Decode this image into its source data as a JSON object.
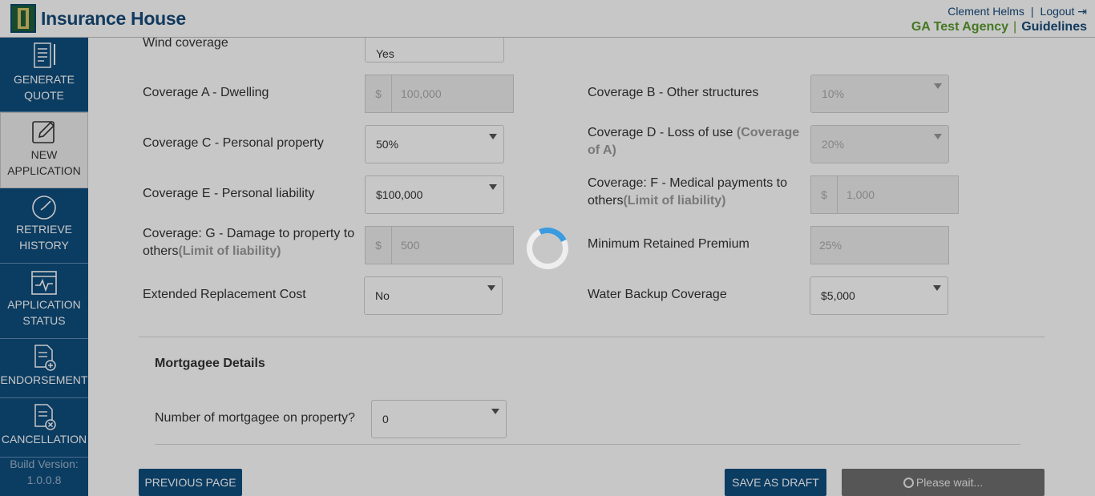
{
  "header": {
    "brand": "Insurance House",
    "user_name": "Clement Helms",
    "separator": "|",
    "logout": "Logout",
    "logout_icon": "⇥",
    "agency": "GA Test Agency",
    "guidelines": "Guidelines"
  },
  "sidebar": {
    "items": [
      {
        "label": "GENERATE QUOTE",
        "icon": "document-list-icon"
      },
      {
        "label": "NEW APPLICATION",
        "icon": "edit-document-icon"
      },
      {
        "label": "RETRIEVE HISTORY",
        "icon": "history-icon"
      },
      {
        "label": "APPLICATION STATUS",
        "icon": "activity-monitor-icon"
      },
      {
        "label": "ENDORSEMENT",
        "icon": "document-add-icon"
      },
      {
        "label": "CANCELLATION",
        "icon": "document-cancel-icon"
      }
    ],
    "build_label": "Build Version:",
    "build_value": "1.0.0.8"
  },
  "form": {
    "wind_coverage": {
      "label": "Wind coverage",
      "value": "Yes"
    },
    "coverage_a": {
      "label": "Coverage A - Dwelling",
      "symbol": "$",
      "value": "100,000"
    },
    "coverage_b": {
      "label": "Coverage B - Other structures",
      "value": "10%"
    },
    "coverage_c": {
      "label": "Coverage C - Personal property",
      "value": "50%"
    },
    "coverage_d": {
      "label": "Coverage D - Loss of use",
      "note": "(Coverage of A)",
      "value": "20%"
    },
    "coverage_e": {
      "label": "Coverage E - Personal liability",
      "value": "$100,000"
    },
    "coverage_f": {
      "label": "Coverage: F - Medical payments to others",
      "note": "(Limit of liability)",
      "symbol": "$",
      "value": "1,000"
    },
    "coverage_g": {
      "label": "Coverage: G - Damage to property to others",
      "note": "(Limit of liability)",
      "symbol": "$",
      "value": "500"
    },
    "min_premium": {
      "label": "Minimum Retained Premium",
      "value": "25%"
    },
    "extended_replacement": {
      "label": "Extended Replacement Cost",
      "value": "No"
    },
    "water_backup": {
      "label": "Water Backup Coverage",
      "value": "$5,000"
    }
  },
  "mortgagee": {
    "title": "Mortgagee Details",
    "count_label": "Number of mortgagee on property?",
    "count_value": "0"
  },
  "buttons": {
    "previous": "PREVIOUS PAGE",
    "save_draft": "SAVE AS DRAFT",
    "please_wait": "Please wait..."
  },
  "colors": {
    "primary": "#0f4e7e",
    "agency_green": "#5a9a2e",
    "loader_accent": "#3a9be0"
  }
}
